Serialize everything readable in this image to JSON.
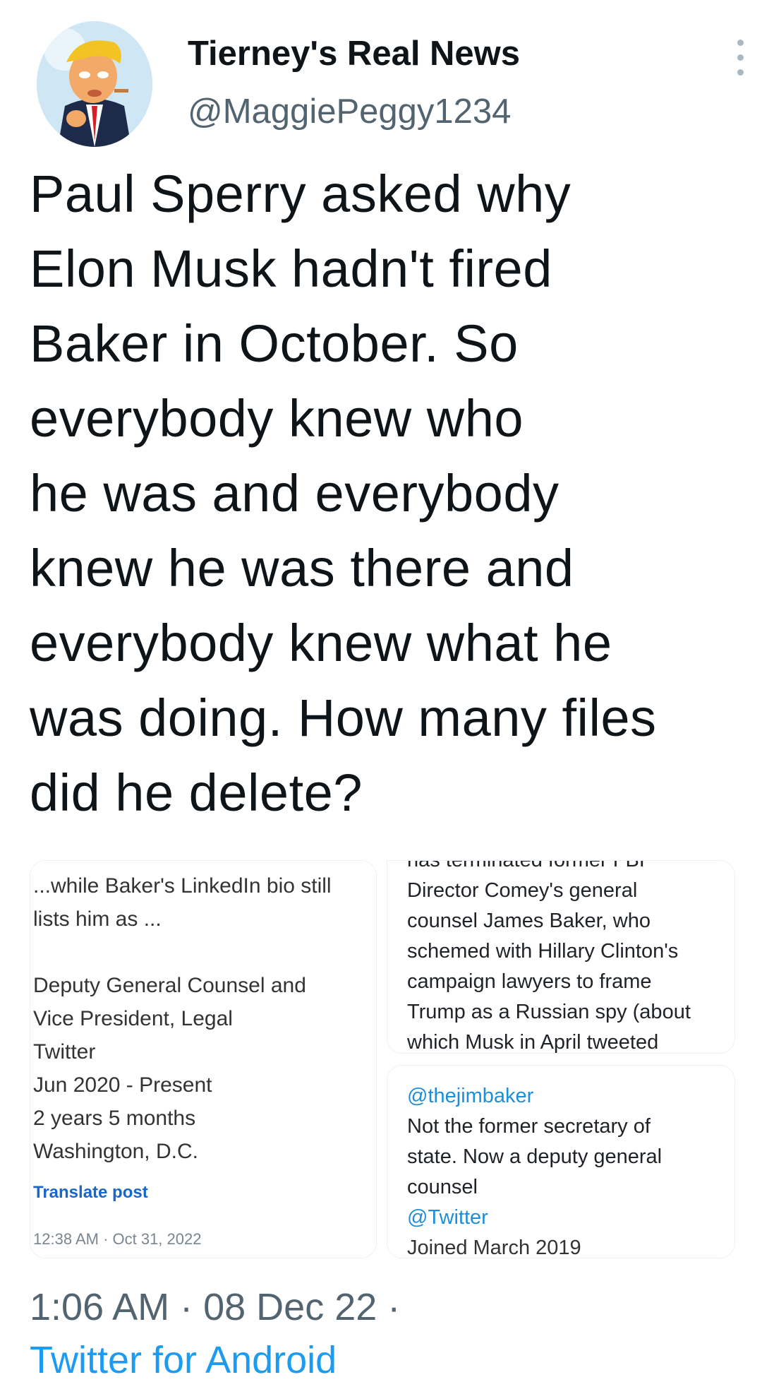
{
  "author": {
    "display_name": "Tierney's Real News",
    "handle": "@MaggiePeggy1234"
  },
  "tweet": {
    "lines": [
      "Paul Sperry asked why",
      "Elon Musk hadn't fired",
      "Baker in October. So",
      "everybody knew who",
      "he was and everybody",
      "knew he was there and",
      "everybody knew what he",
      "was doing. How many files",
      "did he delete?"
    ]
  },
  "media": {
    "left_card": {
      "lines": [
        "...while Baker's LinkedIn bio still",
        "lists him as ...",
        "",
        "Deputy General Counsel and",
        "Vice President, Legal",
        "Twitter",
        "Jun 2020 - Present",
        "2 years 5 months",
        "Washington, D.C."
      ],
      "translate_label": "Translate post",
      "timestamp": "12:38 AM · Oct 31, 2022"
    },
    "right_top_card": {
      "lines": [
        "has terminated former FBI",
        "Director Comey's general",
        "counsel James Baker, who",
        "schemed with Hillary Clinton's",
        "campaign lawyers to frame",
        "Trump as a Russian spy (about",
        "which Musk in April tweeted"
      ]
    },
    "right_bottom_card": {
      "mention": "@thejimbaker",
      "bio_lines": [
        "Not the former secretary of",
        "state. Now a deputy general",
        "counsel"
      ],
      "link": "@Twitter",
      "joined": "Joined March 2019"
    }
  },
  "footer": {
    "time_date": "1:06 AM · 08 Dec 22 ·",
    "source": "Twitter for Android"
  },
  "icons": {
    "more": "more-vertical-icon"
  },
  "colors": {
    "link": "#1d9bf0",
    "secondary_text": "#536471",
    "primary_text": "#0f1419"
  }
}
